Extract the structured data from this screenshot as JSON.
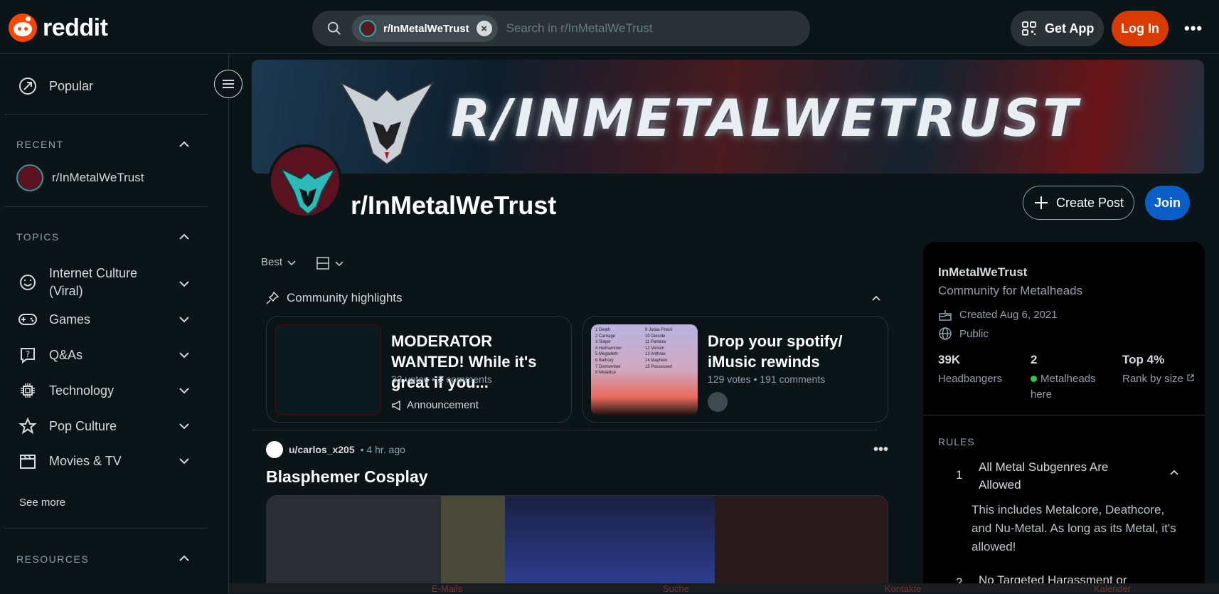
{
  "header": {
    "logo_text": "reddit",
    "search": {
      "chip_label": "r/InMetalWeTrust",
      "placeholder": "Search in r/InMetalWeTrust"
    },
    "get_app_label": "Get App",
    "login_label": "Log In"
  },
  "sidebar": {
    "popular_label": "Popular",
    "recent_heading": "RECENT",
    "recent_items": [
      {
        "label": "r/InMetalWeTrust"
      }
    ],
    "topics_heading": "TOPICS",
    "topics": [
      {
        "label": "Internet Culture\n(Viral)",
        "icon": "smile-icon"
      },
      {
        "label": "Games",
        "icon": "gamepad-icon"
      },
      {
        "label": "Q&As",
        "icon": "question-icon"
      },
      {
        "label": "Technology",
        "icon": "chip-icon"
      },
      {
        "label": "Pop Culture",
        "icon": "star-icon"
      },
      {
        "label": "Movies & TV",
        "icon": "clapper-icon"
      }
    ],
    "see_more": "See more",
    "resources_heading": "RESOURCES"
  },
  "subreddit": {
    "banner_text": "R/INMETALWETRUST",
    "title": "r/InMetalWeTrust",
    "create_post_label": "Create Post",
    "join_label": "Join"
  },
  "feed": {
    "sort_label": "Best",
    "highlights_heading": "Community highlights",
    "highlights": [
      {
        "title": "MODERATOR WANTED! While it's great if you...",
        "meta": "33 votes • 2 comments",
        "tag": "Announcement"
      },
      {
        "title": "Drop your spotify/ iMusic rewinds",
        "meta": "129 votes • 191 comments",
        "thumb_list_left": [
          "1 Death",
          "2 Carnage",
          "3 Slayer",
          "4 Hellhammer",
          "5 Megadeth",
          "6 Bathory",
          "7 Dismember",
          "8 Metallica"
        ],
        "thumb_list_right": [
          "9 Judas Priest",
          "10 Deicide",
          "11 Pantera",
          "12 Venom",
          "13 Anthrax",
          "14 Mayhem",
          "15 Possessed"
        ]
      }
    ],
    "post": {
      "user": "u/carlos_x205",
      "time": "• 4 hr. ago",
      "title": "Blasphemer Cosplay"
    }
  },
  "about": {
    "name": "InMetalWeTrust",
    "description": "Community for Metalheads",
    "created": "Created Aug 6, 2021",
    "visibility": "Public",
    "stats": [
      {
        "value": "39K",
        "label": "Headbangers"
      },
      {
        "value": "2",
        "label": "Metalheads here"
      },
      {
        "value": "Top 4%",
        "label": "Rank by size"
      }
    ],
    "rules_heading": "RULES",
    "rules": [
      {
        "num": "1",
        "title": "All Metal Subgenres Are Allowed",
        "body": "This includes Metalcore, Deathcore, and Nu-Metal. As long as its Metal, it's allowed!"
      },
      {
        "num": "2",
        "title": "No Targeted Harassment or"
      }
    ]
  },
  "taskbar": [
    "E-Mails",
    "Suche",
    "Kontakte",
    "Kalender"
  ],
  "colors": {
    "accent": "#d93a00",
    "join": "#0a5ec9",
    "bg": "#0b1416"
  }
}
